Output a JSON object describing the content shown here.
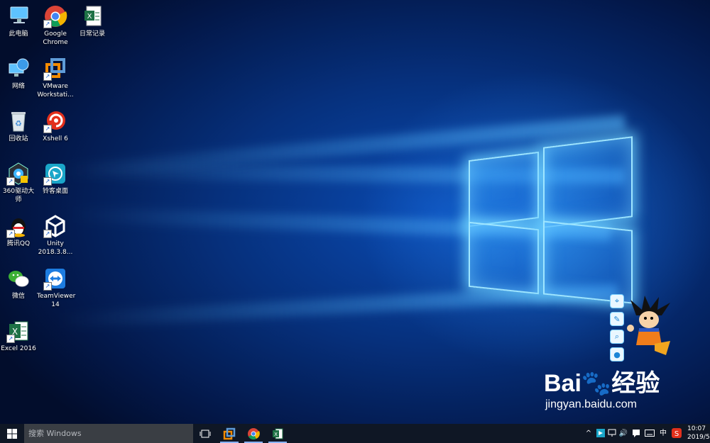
{
  "desktop_icons": [
    {
      "label": "此电脑",
      "icon": "computer-icon"
    },
    {
      "label": "Google Chrome",
      "icon": "chrome-icon"
    },
    {
      "label": "日常记录",
      "icon": "excel-file-icon"
    },
    {
      "label": "网络",
      "icon": "network-icon"
    },
    {
      "label": "VMware Workstati...",
      "icon": "vmware-icon"
    },
    {
      "label": "回收站",
      "icon": "recycle-bin-icon"
    },
    {
      "label": "Xshell 6",
      "icon": "xshell-icon"
    },
    {
      "label": "360驱动大师",
      "icon": "driver-master-icon"
    },
    {
      "label": "铃客桌面",
      "icon": "lingke-desktop-icon"
    },
    {
      "label": "腾讯QQ",
      "icon": "qq-icon"
    },
    {
      "label": "Unity 2018.3.8...",
      "icon": "unity-icon"
    },
    {
      "label": "微信",
      "icon": "wechat-icon"
    },
    {
      "label": "TeamViewer 14",
      "icon": "teamviewer-icon"
    },
    {
      "label": "Excel 2016",
      "icon": "excel-icon"
    }
  ],
  "watermark": {
    "brand_a": "Bai",
    "brand_b": "经验",
    "url": "jingyan.baidu.com"
  },
  "taskbar": {
    "search_placeholder": "搜索 Windows",
    "apps": [
      "vmware-icon",
      "chrome-icon",
      "excel-icon"
    ],
    "ime": "中",
    "time": "10:07",
    "date": "2019/5"
  },
  "colors": {
    "taskbar": "#0f1725",
    "accent": "#1a73e8",
    "excel_green": "#1e7145"
  }
}
